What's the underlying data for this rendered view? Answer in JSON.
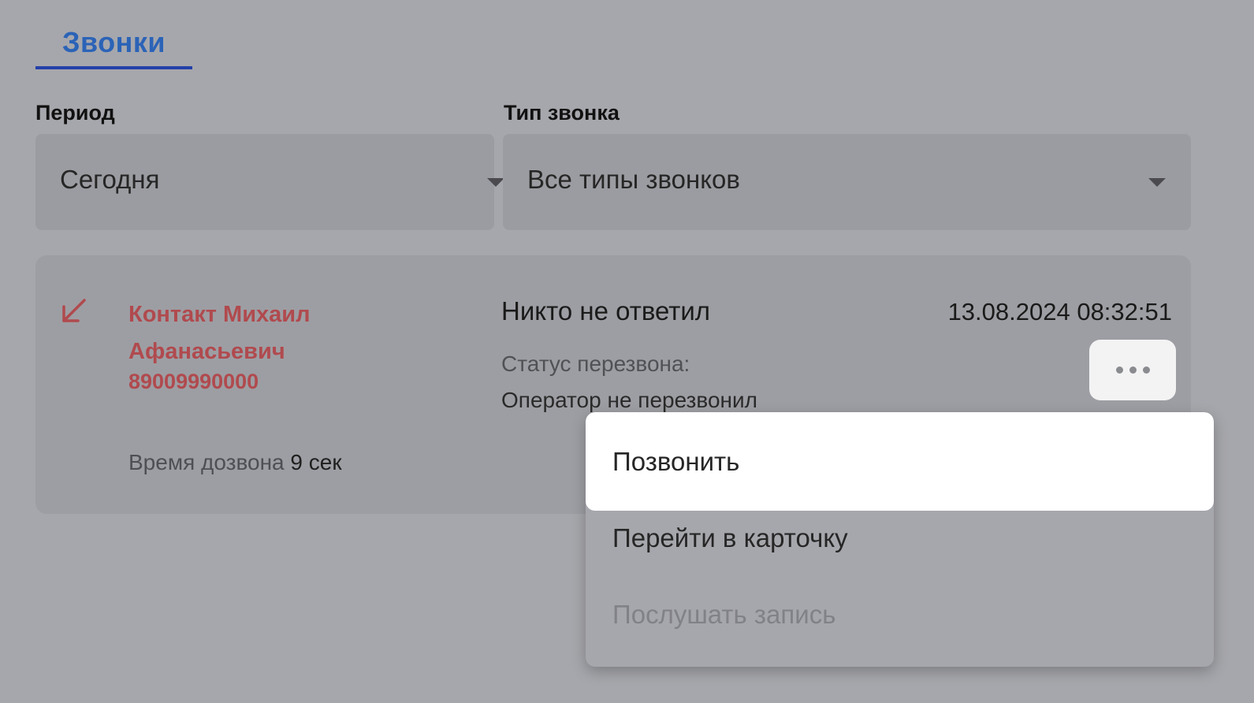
{
  "tabs": {
    "active_label": "Звонки"
  },
  "filters": {
    "period": {
      "label": "Период",
      "value": "Сегодня"
    },
    "call_type": {
      "label": "Тип звонка",
      "value": "Все типы звонков"
    }
  },
  "call": {
    "direction_icon": "incoming-arrow-icon",
    "contact_name": "Контакт Михаил Афанасьевич",
    "phone": "89009990000",
    "ring_time_label": "Время дозвона",
    "ring_time_value": "9 сек",
    "result": "Никто не ответил",
    "datetime": "13.08.2024 08:32:51",
    "callback_status_label": "Статус перезвона:",
    "callback_status_value": "Оператор не перезвонил",
    "more_icon": "more-horizontal-icon"
  },
  "context_menu": {
    "items": [
      {
        "label": "Позвонить",
        "state": "highlighted"
      },
      {
        "label": "Перейти в карточку",
        "state": "enabled"
      },
      {
        "label": "Послушать запись",
        "state": "disabled"
      }
    ]
  },
  "colors": {
    "tab_text": "#2b63b7",
    "tab_underline": "#2540a8",
    "missed_call": "#b04a4e",
    "overlay_background": "#a6a7ac"
  }
}
